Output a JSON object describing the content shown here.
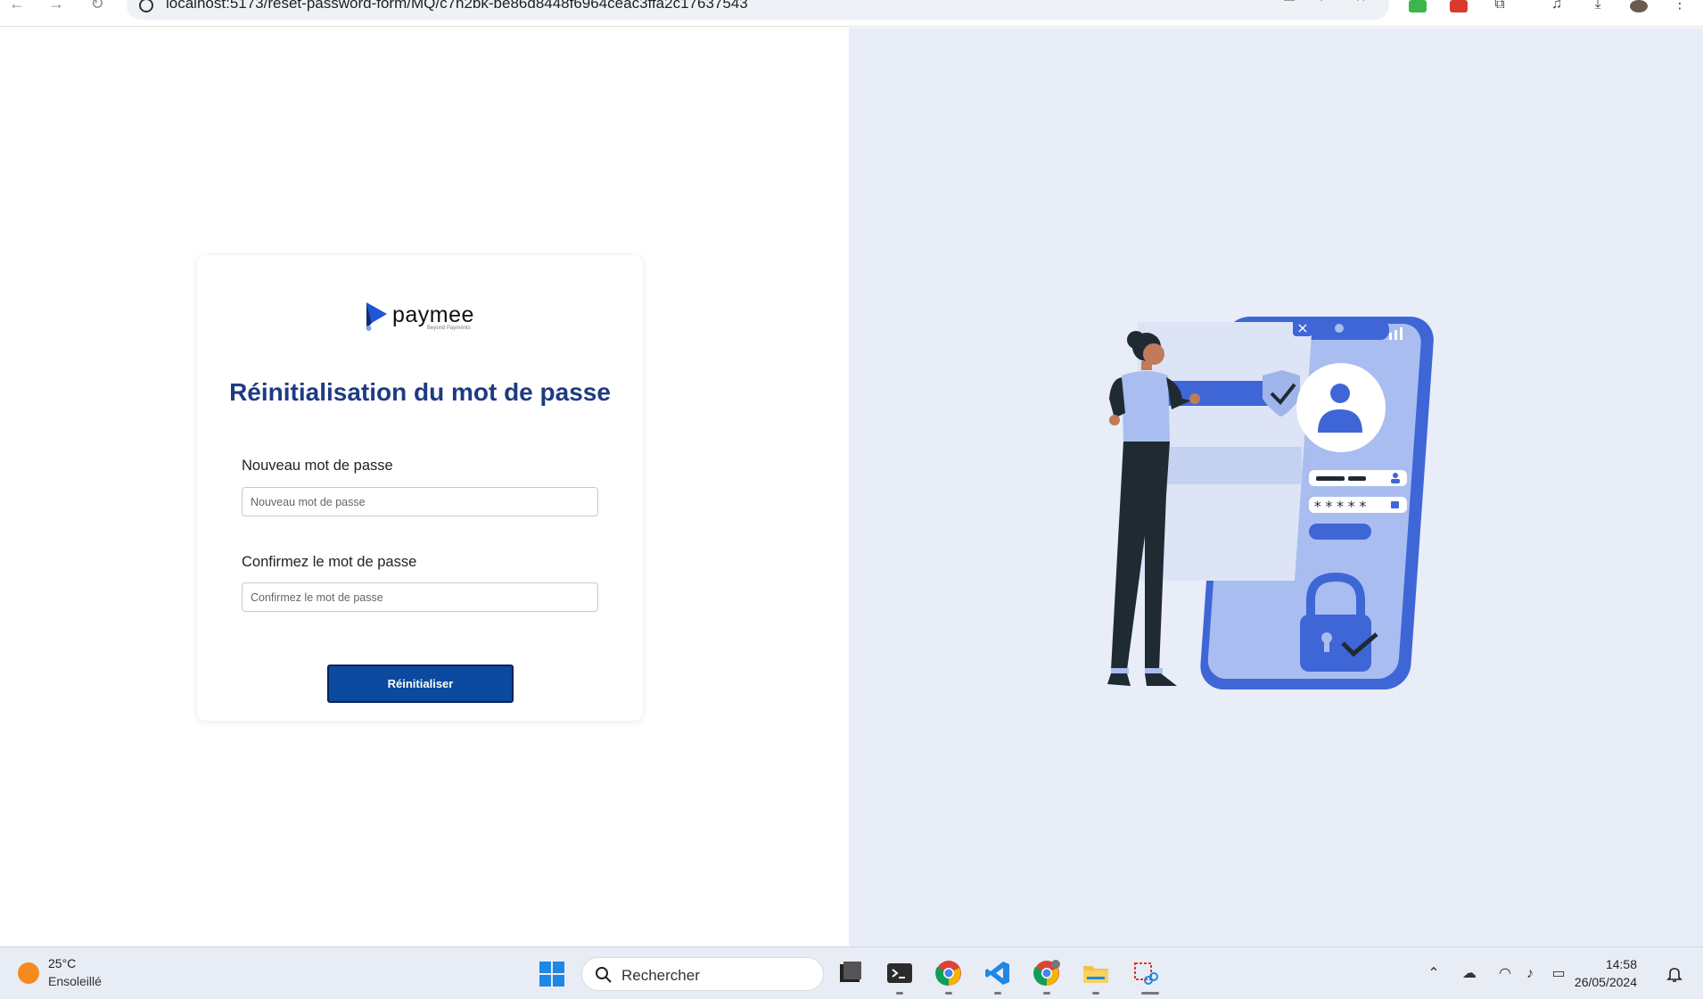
{
  "browser": {
    "url": "localhost:5173/reset-password-form/MQ/c7h2bk-be86d8448f6964ceac3ffa2c17637543"
  },
  "brand": {
    "name": "paymee",
    "tagline": "Beyond Payments"
  },
  "form": {
    "title": "Réinitialisation du mot de passe",
    "new_password_label": "Nouveau mot de passe",
    "new_password_placeholder": "Nouveau mot de passe",
    "confirm_password_label": "Confirmez le mot de passe",
    "confirm_password_placeholder": "Confirmez le mot de passe",
    "submit_label": "Réinitialiser"
  },
  "illustration": {
    "masked_password": "*****"
  },
  "taskbar": {
    "weather_temp": "25°C",
    "weather_condition": "Ensoleillé",
    "search_placeholder": "Rechercher",
    "time": "14:58",
    "date": "26/05/2024",
    "apps": [
      "file-explorer-icon",
      "terminal-icon",
      "chrome-icon",
      "vscode-icon",
      "chrome-profile-icon",
      "folder-icon",
      "snipping-tool-icon"
    ]
  },
  "colors": {
    "title": "#1e3b82",
    "button": "#0b4a9e",
    "right_panel_bg": "#e8edf7",
    "illustration_accent": "#3f66d6"
  }
}
